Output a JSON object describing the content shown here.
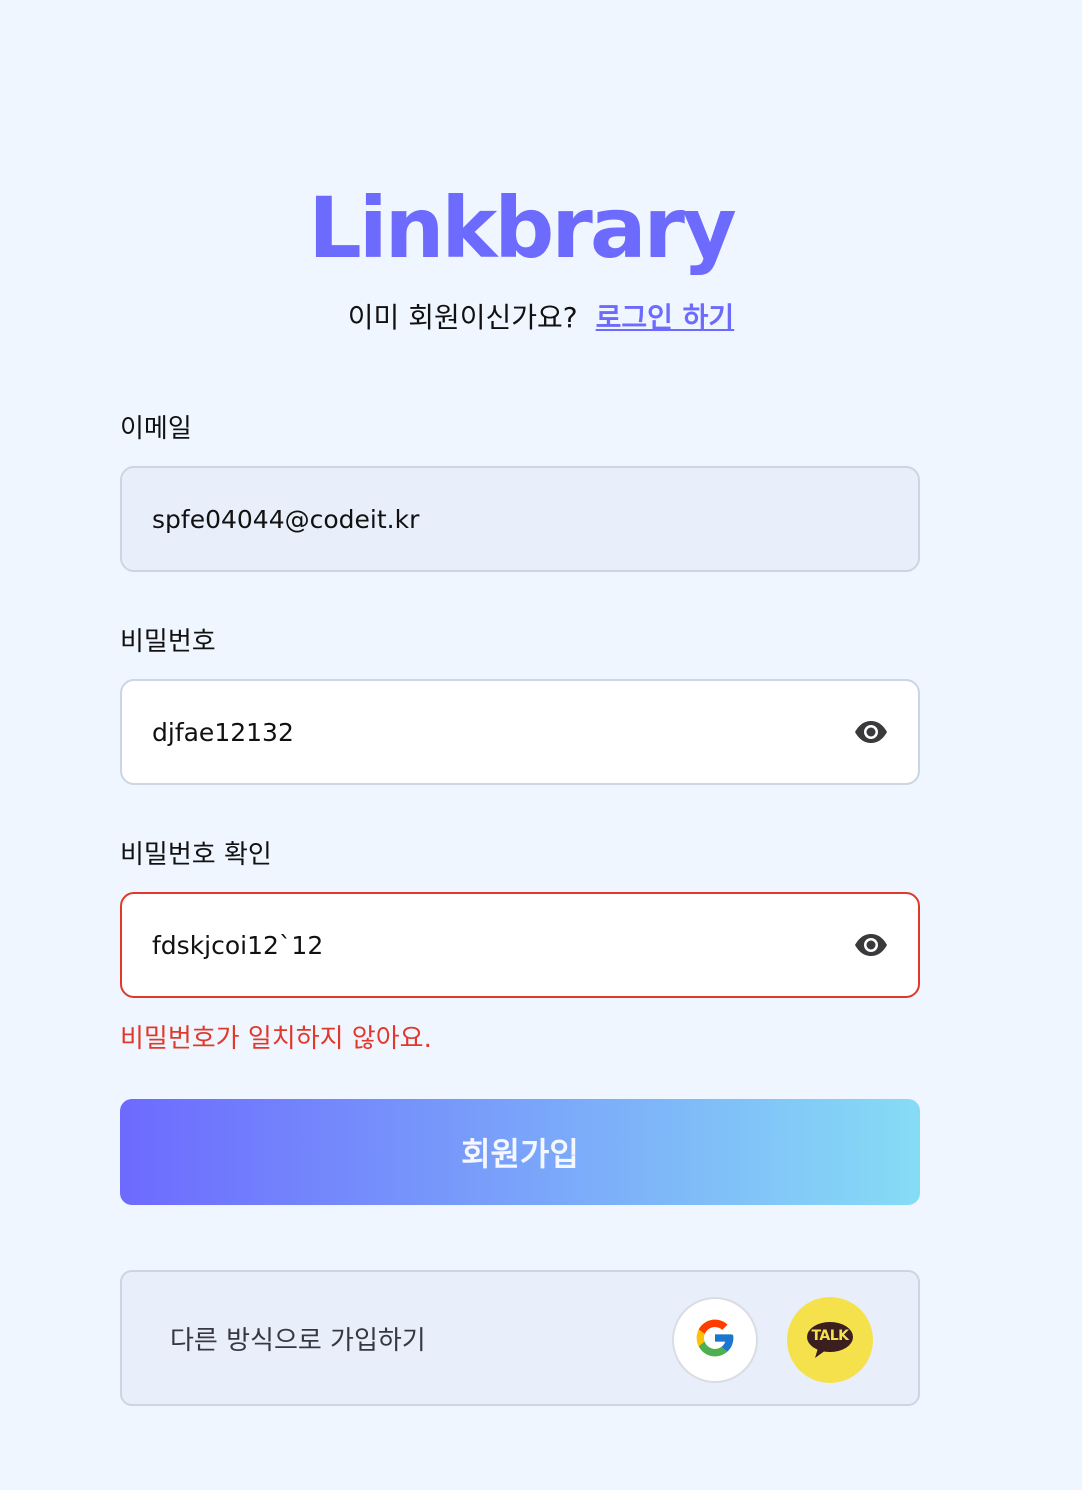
{
  "brand": {
    "logo_text": "Linkbrary",
    "color": "#6d6afe"
  },
  "signin_prompt": {
    "text": "이미 회원이신가요?",
    "link": "로그인 하기"
  },
  "form": {
    "email": {
      "label": "이메일",
      "value": "spfe04044@codeit.kr"
    },
    "password": {
      "label": "비밀번호",
      "value": "djfae12132",
      "toggle_icon": "eye-icon"
    },
    "password_confirm": {
      "label": "비밀번호 확인",
      "value": "fdskjcoi12`12",
      "toggle_icon": "eye-icon"
    },
    "error_message": "비밀번호가 일치하지 않아요.",
    "submit_label": "회원가입"
  },
  "social": {
    "label": "다른 방식으로 가입하기",
    "providers": [
      {
        "name": "google",
        "icon": "google-icon"
      },
      {
        "name": "kakao",
        "icon": "kakao-talk-icon",
        "text": "TALK"
      }
    ]
  },
  "colors": {
    "accent": "#6d6afe",
    "error": "#e0392b",
    "kakao": "#f5e14b",
    "background": "#f0f6ff"
  }
}
